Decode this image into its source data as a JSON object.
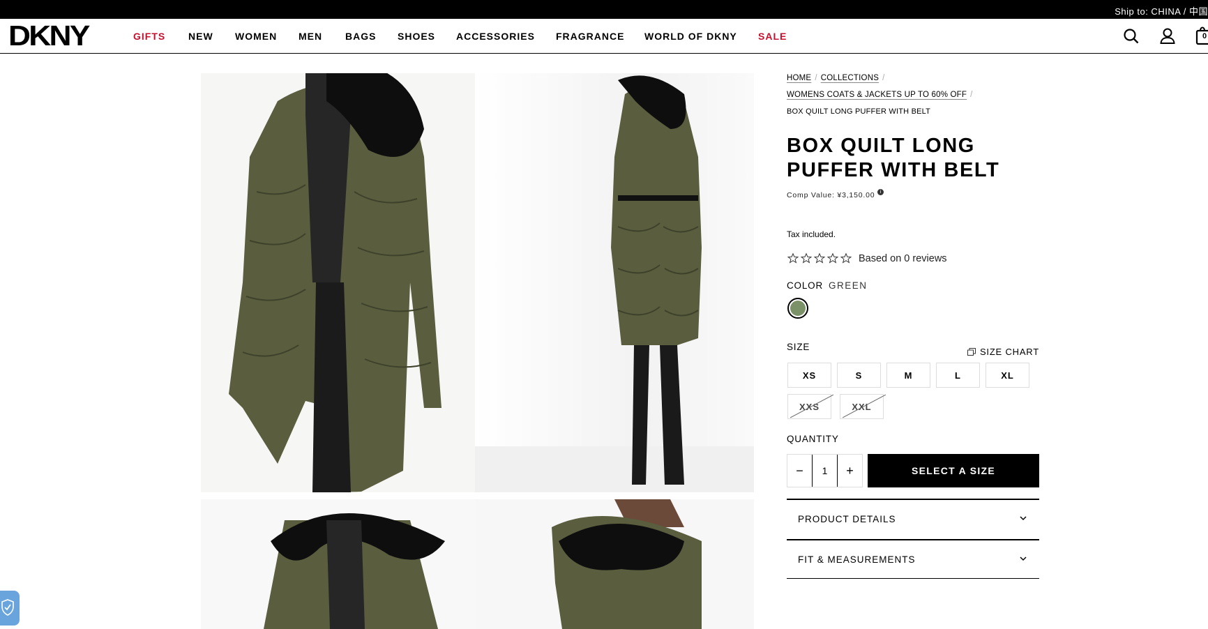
{
  "topbar": {
    "ship_to": "Ship to: CHINA / 中国"
  },
  "header": {
    "logo": "DKNY",
    "nav": [
      {
        "label": "GIFTS",
        "highlight": true
      },
      {
        "label": "NEW",
        "highlight": false
      },
      {
        "label": "WOMEN",
        "highlight": false
      },
      {
        "label": "MEN",
        "highlight": false
      },
      {
        "label": "BAGS",
        "highlight": false
      },
      {
        "label": "SHOES",
        "highlight": false
      },
      {
        "label": "ACCESSORIES",
        "highlight": false
      },
      {
        "label": "FRAGRANCE",
        "highlight": false
      },
      {
        "label": "WORLD OF DKNY",
        "highlight": false
      },
      {
        "label": "SALE",
        "highlight": true
      }
    ],
    "icons": [
      "search-icon",
      "account-icon",
      "cart-icon"
    ],
    "cart_count": "0"
  },
  "breadcrumb": {
    "home": "HOME",
    "collections": "COLLECTIONS",
    "category": "WOMENS COATS & JACKETS UP TO 60% OFF",
    "current": "BOX QUILT LONG PUFFER WITH BELT"
  },
  "product": {
    "title": "BOX QUILT LONG PUFFER WITH BELT",
    "comp_value": "Comp Value: ¥3,150.00",
    "tax_note": "Tax included.",
    "reviews_text": "Based on 0 reviews",
    "rating": 0,
    "color_label": "COLOR",
    "color_value": "GREEN",
    "swatch_color": "#7b9167",
    "size_label": "SIZE",
    "size_chart": "SIZE CHART",
    "sizes": [
      {
        "label": "XS",
        "available": true
      },
      {
        "label": "S",
        "available": true
      },
      {
        "label": "M",
        "available": true
      },
      {
        "label": "L",
        "available": true
      },
      {
        "label": "XL",
        "available": true
      },
      {
        "label": "XXS",
        "available": false
      },
      {
        "label": "XXL",
        "available": false
      }
    ],
    "quantity_label": "QUANTITY",
    "quantity": "1",
    "minus": "−",
    "plus": "+",
    "add_button": "SELECT A SIZE",
    "accordions": [
      "PRODUCT DETAILS",
      "FIT & MEASUREMENTS"
    ]
  },
  "colors": {
    "accent_red": "#c8102e",
    "coat_olive": "#5a5d3e",
    "trustbadge_blue": "#6aa4dd"
  }
}
